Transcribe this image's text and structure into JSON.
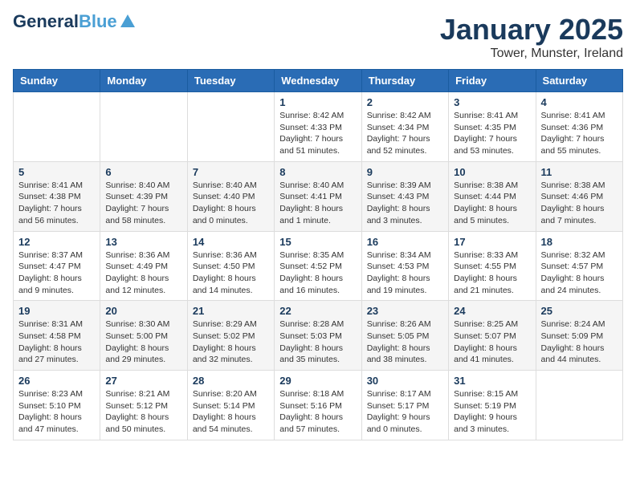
{
  "logo": {
    "general": "General",
    "blue": "Blue",
    "tagline": ""
  },
  "title": "January 2025",
  "location": "Tower, Munster, Ireland",
  "days_header": [
    "Sunday",
    "Monday",
    "Tuesday",
    "Wednesday",
    "Thursday",
    "Friday",
    "Saturday"
  ],
  "weeks": [
    [
      {
        "day": "",
        "info": ""
      },
      {
        "day": "",
        "info": ""
      },
      {
        "day": "",
        "info": ""
      },
      {
        "day": "1",
        "info": "Sunrise: 8:42 AM\nSunset: 4:33 PM\nDaylight: 7 hours\nand 51 minutes."
      },
      {
        "day": "2",
        "info": "Sunrise: 8:42 AM\nSunset: 4:34 PM\nDaylight: 7 hours\nand 52 minutes."
      },
      {
        "day": "3",
        "info": "Sunrise: 8:41 AM\nSunset: 4:35 PM\nDaylight: 7 hours\nand 53 minutes."
      },
      {
        "day": "4",
        "info": "Sunrise: 8:41 AM\nSunset: 4:36 PM\nDaylight: 7 hours\nand 55 minutes."
      }
    ],
    [
      {
        "day": "5",
        "info": "Sunrise: 8:41 AM\nSunset: 4:38 PM\nDaylight: 7 hours\nand 56 minutes."
      },
      {
        "day": "6",
        "info": "Sunrise: 8:40 AM\nSunset: 4:39 PM\nDaylight: 7 hours\nand 58 minutes."
      },
      {
        "day": "7",
        "info": "Sunrise: 8:40 AM\nSunset: 4:40 PM\nDaylight: 8 hours\nand 0 minutes."
      },
      {
        "day": "8",
        "info": "Sunrise: 8:40 AM\nSunset: 4:41 PM\nDaylight: 8 hours\nand 1 minute."
      },
      {
        "day": "9",
        "info": "Sunrise: 8:39 AM\nSunset: 4:43 PM\nDaylight: 8 hours\nand 3 minutes."
      },
      {
        "day": "10",
        "info": "Sunrise: 8:38 AM\nSunset: 4:44 PM\nDaylight: 8 hours\nand 5 minutes."
      },
      {
        "day": "11",
        "info": "Sunrise: 8:38 AM\nSunset: 4:46 PM\nDaylight: 8 hours\nand 7 minutes."
      }
    ],
    [
      {
        "day": "12",
        "info": "Sunrise: 8:37 AM\nSunset: 4:47 PM\nDaylight: 8 hours\nand 9 minutes."
      },
      {
        "day": "13",
        "info": "Sunrise: 8:36 AM\nSunset: 4:49 PM\nDaylight: 8 hours\nand 12 minutes."
      },
      {
        "day": "14",
        "info": "Sunrise: 8:36 AM\nSunset: 4:50 PM\nDaylight: 8 hours\nand 14 minutes."
      },
      {
        "day": "15",
        "info": "Sunrise: 8:35 AM\nSunset: 4:52 PM\nDaylight: 8 hours\nand 16 minutes."
      },
      {
        "day": "16",
        "info": "Sunrise: 8:34 AM\nSunset: 4:53 PM\nDaylight: 8 hours\nand 19 minutes."
      },
      {
        "day": "17",
        "info": "Sunrise: 8:33 AM\nSunset: 4:55 PM\nDaylight: 8 hours\nand 21 minutes."
      },
      {
        "day": "18",
        "info": "Sunrise: 8:32 AM\nSunset: 4:57 PM\nDaylight: 8 hours\nand 24 minutes."
      }
    ],
    [
      {
        "day": "19",
        "info": "Sunrise: 8:31 AM\nSunset: 4:58 PM\nDaylight: 8 hours\nand 27 minutes."
      },
      {
        "day": "20",
        "info": "Sunrise: 8:30 AM\nSunset: 5:00 PM\nDaylight: 8 hours\nand 29 minutes."
      },
      {
        "day": "21",
        "info": "Sunrise: 8:29 AM\nSunset: 5:02 PM\nDaylight: 8 hours\nand 32 minutes."
      },
      {
        "day": "22",
        "info": "Sunrise: 8:28 AM\nSunset: 5:03 PM\nDaylight: 8 hours\nand 35 minutes."
      },
      {
        "day": "23",
        "info": "Sunrise: 8:26 AM\nSunset: 5:05 PM\nDaylight: 8 hours\nand 38 minutes."
      },
      {
        "day": "24",
        "info": "Sunrise: 8:25 AM\nSunset: 5:07 PM\nDaylight: 8 hours\nand 41 minutes."
      },
      {
        "day": "25",
        "info": "Sunrise: 8:24 AM\nSunset: 5:09 PM\nDaylight: 8 hours\nand 44 minutes."
      }
    ],
    [
      {
        "day": "26",
        "info": "Sunrise: 8:23 AM\nSunset: 5:10 PM\nDaylight: 8 hours\nand 47 minutes."
      },
      {
        "day": "27",
        "info": "Sunrise: 8:21 AM\nSunset: 5:12 PM\nDaylight: 8 hours\nand 50 minutes."
      },
      {
        "day": "28",
        "info": "Sunrise: 8:20 AM\nSunset: 5:14 PM\nDaylight: 8 hours\nand 54 minutes."
      },
      {
        "day": "29",
        "info": "Sunrise: 8:18 AM\nSunset: 5:16 PM\nDaylight: 8 hours\nand 57 minutes."
      },
      {
        "day": "30",
        "info": "Sunrise: 8:17 AM\nSunset: 5:17 PM\nDaylight: 9 hours\nand 0 minutes."
      },
      {
        "day": "31",
        "info": "Sunrise: 8:15 AM\nSunset: 5:19 PM\nDaylight: 9 hours\nand 3 minutes."
      },
      {
        "day": "",
        "info": ""
      }
    ]
  ]
}
